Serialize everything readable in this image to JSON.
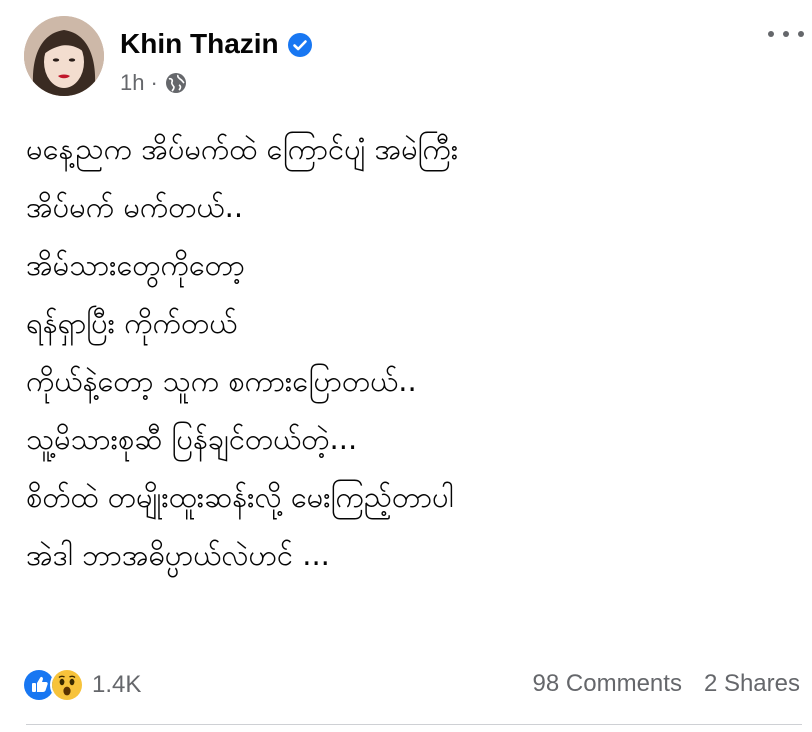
{
  "post": {
    "author": "Khin Thazin",
    "time": "1h",
    "separator": "·",
    "lines": [
      "မနေ့ညက အိပ်မက်ထဲ ကြောင်ပျံ အမဲကြီး",
      "အိပ်မက် မက်တယ်..",
      "အိမ်သားတွေကိုတော့",
      "ရန်ရှာပြီး ကိုက်တယ်",
      "ကိုယ်နဲ့တော့ သူက စကားပြောတယ်..",
      "သူ့မိသားစုဆီ ပြန်ချင်တယ်တဲ့...",
      "စိတ်ထဲ တမျိုးထူးဆန်းလို့ မေးကြည့်တာပါ",
      "အဲဒါ ဘာအဓိပ္ပာယ်လဲဟင် ..."
    ]
  },
  "engagement": {
    "reaction_count": "1.4K",
    "comments": "98 Comments",
    "shares": "2 Shares"
  },
  "icons": {
    "verified": "verified-badge-icon",
    "privacy": "globe-icon",
    "more": "more-options-icon",
    "like": "like-reaction-icon",
    "wow": "wow-reaction-icon"
  },
  "colors": {
    "brand_blue": "#1877f2",
    "secondary_text": "#65676b",
    "wow_yellow": "#f7c33b"
  }
}
